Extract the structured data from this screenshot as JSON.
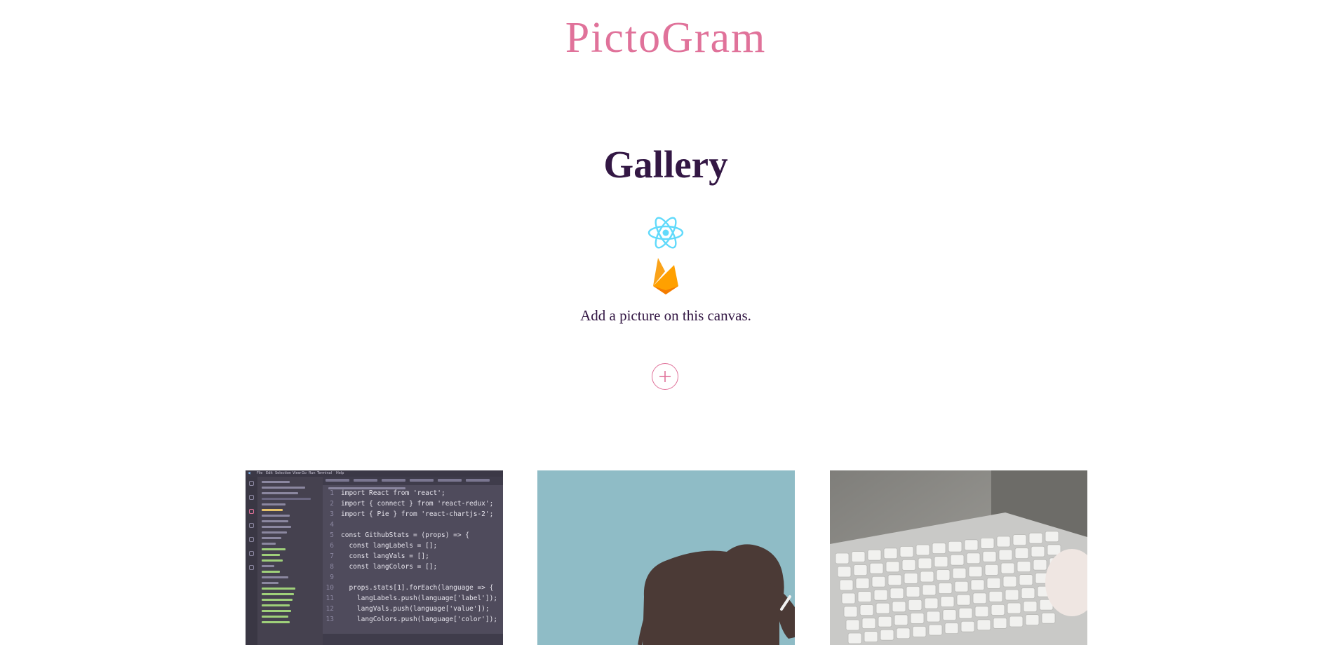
{
  "app": {
    "brand": "PictoGram"
  },
  "main": {
    "heading": "Gallery",
    "icons": [
      "react-logo-icon",
      "firebase-logo-icon"
    ],
    "subtitle": "Add a picture on this canvas.",
    "add_button_icon": "plus-circle-icon"
  },
  "colors": {
    "brand": "#e0729a",
    "heading": "#331744",
    "react": "#61dafb",
    "firebase": "#f5a623"
  },
  "gallery": {
    "items": [
      {
        "subject": "code-editor-screenshot",
        "menu": [
          "File",
          "Edit",
          "Selection",
          "View",
          "Go",
          "Run",
          "Terminal",
          "Help"
        ],
        "code_lines": [
          {
            "n": "1",
            "text": "import React from 'react';"
          },
          {
            "n": "2",
            "text": "import { connect } from 'react-redux';"
          },
          {
            "n": "3",
            "text": "import { Pie } from 'react-chartjs-2';"
          },
          {
            "n": "4",
            "text": ""
          },
          {
            "n": "5",
            "text": "const GithubStats = (props) => {"
          },
          {
            "n": "6",
            "text": "  const langLabels = [];"
          },
          {
            "n": "7",
            "text": "  const langVals = [];"
          },
          {
            "n": "8",
            "text": "  const langColors = [];"
          },
          {
            "n": "9",
            "text": ""
          },
          {
            "n": "10",
            "text": "  props.stats[1].forEach(language => {"
          },
          {
            "n": "11",
            "text": "    langLabels.push(language['label']);"
          },
          {
            "n": "12",
            "text": "    langVals.push(language['value']);"
          },
          {
            "n": "13",
            "text": "    langColors.push(language['color']);"
          }
        ]
      },
      {
        "subject": "elephant-illustration"
      },
      {
        "subject": "keyboard-photo"
      }
    ]
  }
}
